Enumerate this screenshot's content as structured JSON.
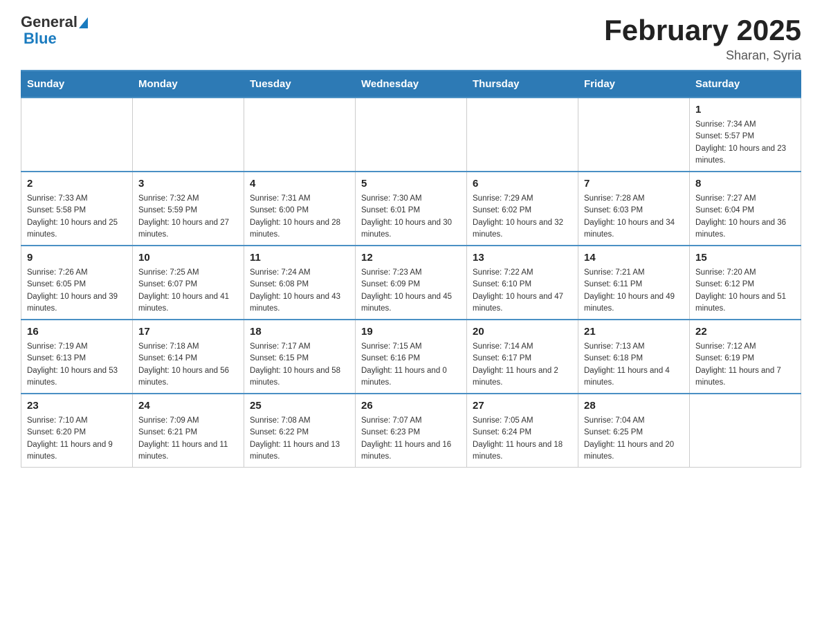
{
  "logo": {
    "text_general": "General",
    "text_blue": "Blue"
  },
  "title": "February 2025",
  "location": "Sharan, Syria",
  "days_of_week": [
    "Sunday",
    "Monday",
    "Tuesday",
    "Wednesday",
    "Thursday",
    "Friday",
    "Saturday"
  ],
  "weeks": [
    [
      {
        "day": "",
        "info": ""
      },
      {
        "day": "",
        "info": ""
      },
      {
        "day": "",
        "info": ""
      },
      {
        "day": "",
        "info": ""
      },
      {
        "day": "",
        "info": ""
      },
      {
        "day": "",
        "info": ""
      },
      {
        "day": "1",
        "info": "Sunrise: 7:34 AM\nSunset: 5:57 PM\nDaylight: 10 hours and 23 minutes."
      }
    ],
    [
      {
        "day": "2",
        "info": "Sunrise: 7:33 AM\nSunset: 5:58 PM\nDaylight: 10 hours and 25 minutes."
      },
      {
        "day": "3",
        "info": "Sunrise: 7:32 AM\nSunset: 5:59 PM\nDaylight: 10 hours and 27 minutes."
      },
      {
        "day": "4",
        "info": "Sunrise: 7:31 AM\nSunset: 6:00 PM\nDaylight: 10 hours and 28 minutes."
      },
      {
        "day": "5",
        "info": "Sunrise: 7:30 AM\nSunset: 6:01 PM\nDaylight: 10 hours and 30 minutes."
      },
      {
        "day": "6",
        "info": "Sunrise: 7:29 AM\nSunset: 6:02 PM\nDaylight: 10 hours and 32 minutes."
      },
      {
        "day": "7",
        "info": "Sunrise: 7:28 AM\nSunset: 6:03 PM\nDaylight: 10 hours and 34 minutes."
      },
      {
        "day": "8",
        "info": "Sunrise: 7:27 AM\nSunset: 6:04 PM\nDaylight: 10 hours and 36 minutes."
      }
    ],
    [
      {
        "day": "9",
        "info": "Sunrise: 7:26 AM\nSunset: 6:05 PM\nDaylight: 10 hours and 39 minutes."
      },
      {
        "day": "10",
        "info": "Sunrise: 7:25 AM\nSunset: 6:07 PM\nDaylight: 10 hours and 41 minutes."
      },
      {
        "day": "11",
        "info": "Sunrise: 7:24 AM\nSunset: 6:08 PM\nDaylight: 10 hours and 43 minutes."
      },
      {
        "day": "12",
        "info": "Sunrise: 7:23 AM\nSunset: 6:09 PM\nDaylight: 10 hours and 45 minutes."
      },
      {
        "day": "13",
        "info": "Sunrise: 7:22 AM\nSunset: 6:10 PM\nDaylight: 10 hours and 47 minutes."
      },
      {
        "day": "14",
        "info": "Sunrise: 7:21 AM\nSunset: 6:11 PM\nDaylight: 10 hours and 49 minutes."
      },
      {
        "day": "15",
        "info": "Sunrise: 7:20 AM\nSunset: 6:12 PM\nDaylight: 10 hours and 51 minutes."
      }
    ],
    [
      {
        "day": "16",
        "info": "Sunrise: 7:19 AM\nSunset: 6:13 PM\nDaylight: 10 hours and 53 minutes."
      },
      {
        "day": "17",
        "info": "Sunrise: 7:18 AM\nSunset: 6:14 PM\nDaylight: 10 hours and 56 minutes."
      },
      {
        "day": "18",
        "info": "Sunrise: 7:17 AM\nSunset: 6:15 PM\nDaylight: 10 hours and 58 minutes."
      },
      {
        "day": "19",
        "info": "Sunrise: 7:15 AM\nSunset: 6:16 PM\nDaylight: 11 hours and 0 minutes."
      },
      {
        "day": "20",
        "info": "Sunrise: 7:14 AM\nSunset: 6:17 PM\nDaylight: 11 hours and 2 minutes."
      },
      {
        "day": "21",
        "info": "Sunrise: 7:13 AM\nSunset: 6:18 PM\nDaylight: 11 hours and 4 minutes."
      },
      {
        "day": "22",
        "info": "Sunrise: 7:12 AM\nSunset: 6:19 PM\nDaylight: 11 hours and 7 minutes."
      }
    ],
    [
      {
        "day": "23",
        "info": "Sunrise: 7:10 AM\nSunset: 6:20 PM\nDaylight: 11 hours and 9 minutes."
      },
      {
        "day": "24",
        "info": "Sunrise: 7:09 AM\nSunset: 6:21 PM\nDaylight: 11 hours and 11 minutes."
      },
      {
        "day": "25",
        "info": "Sunrise: 7:08 AM\nSunset: 6:22 PM\nDaylight: 11 hours and 13 minutes."
      },
      {
        "day": "26",
        "info": "Sunrise: 7:07 AM\nSunset: 6:23 PM\nDaylight: 11 hours and 16 minutes."
      },
      {
        "day": "27",
        "info": "Sunrise: 7:05 AM\nSunset: 6:24 PM\nDaylight: 11 hours and 18 minutes."
      },
      {
        "day": "28",
        "info": "Sunrise: 7:04 AM\nSunset: 6:25 PM\nDaylight: 11 hours and 20 minutes."
      },
      {
        "day": "",
        "info": ""
      }
    ]
  ]
}
